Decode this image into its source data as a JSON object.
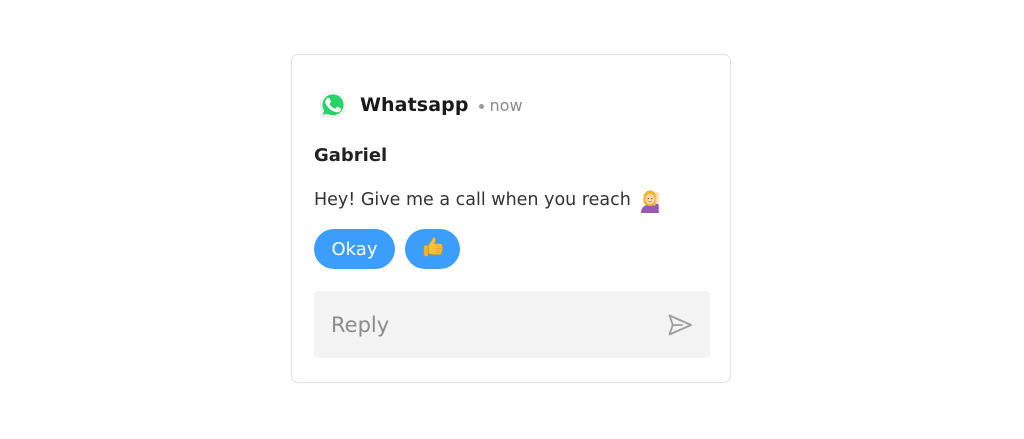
{
  "notification": {
    "app_name": "Whatsapp",
    "app_icon": "whatsapp-icon",
    "separator": "•",
    "time": "now",
    "sender": "Gabriel",
    "message": "Hey! Give me a call when you reach",
    "message_emoji": "woman-raising-hand-phone-emoji"
  },
  "quick_replies": [
    {
      "label": "Okay"
    },
    {
      "label": "👍",
      "icon": "thumbs-up-emoji"
    }
  ],
  "reply": {
    "placeholder": "Reply",
    "value": "",
    "send_icon": "send-icon"
  },
  "colors": {
    "accent": "#3b9eff",
    "whatsapp_green": "#25d366",
    "reply_bg": "#f3f3f3",
    "card_border": "#e2e2e2"
  }
}
